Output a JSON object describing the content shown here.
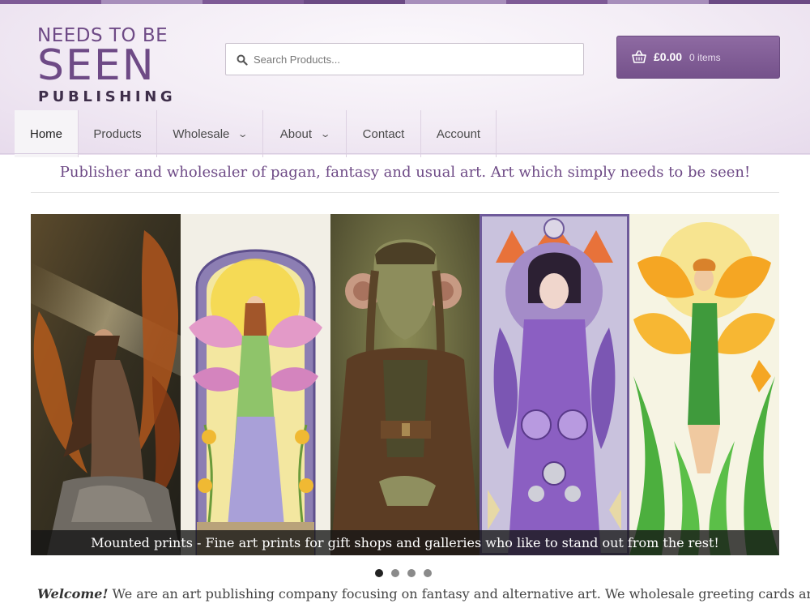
{
  "colors": {
    "brand_purple": "#6e4a86",
    "cart_bg": "#7d5b93",
    "top_strip": [
      "#7e5a96",
      "#a78ebb",
      "#7e5a96",
      "#6b4a84",
      "#a78ebb",
      "#7e5a96",
      "#a78ebb",
      "#6b4a84"
    ]
  },
  "logo": {
    "line1": "NEEDS TO BE",
    "line2": "SEEN",
    "line3": "PUBLISHING"
  },
  "search": {
    "placeholder": "Search Products...",
    "icon": "search-icon"
  },
  "cart": {
    "icon": "basket-icon",
    "amount": "£0.00",
    "items": "0 items"
  },
  "nav": {
    "items": [
      {
        "label": "Home",
        "active": true,
        "dropdown": false
      },
      {
        "label": "Products",
        "active": false,
        "dropdown": false
      },
      {
        "label": "Wholesale",
        "active": false,
        "dropdown": true
      },
      {
        "label": "About",
        "active": false,
        "dropdown": true
      },
      {
        "label": "Contact",
        "active": false,
        "dropdown": false
      },
      {
        "label": "Account",
        "active": false,
        "dropdown": false
      }
    ]
  },
  "tagline": "Publisher and wholesaler of pagan, fantasy and usual art. Art which simply needs to be seen!",
  "slider": {
    "caption": "Mounted prints - Fine art prints for gift shops and galleries who like to stand out from the rest!",
    "slides_count": 4,
    "active_index": 0
  },
  "welcome": {
    "lead": "Welcome!",
    "text": " We are an art publishing company focusing on fantasy and alternative art. We wholesale greeting cards and"
  }
}
